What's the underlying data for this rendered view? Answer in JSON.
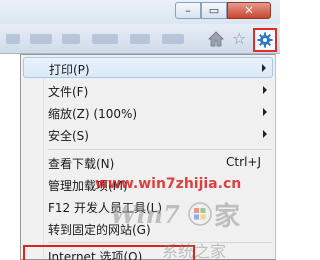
{
  "window": {
    "minimize_glyph": "–",
    "maximize_glyph": "▭",
    "close_glyph": "✕"
  },
  "toolbar": {
    "icons": [
      "home-icon",
      "favorites-star-icon",
      "tools-gear-icon"
    ],
    "highlight_color": "#e02b2b"
  },
  "menu": {
    "items": [
      {
        "label": "打印(P)",
        "submenu": true
      },
      {
        "label": "文件(F)",
        "submenu": true
      },
      {
        "label": "缩放(Z) (100%)",
        "submenu": true
      },
      {
        "label": "安全(S)",
        "submenu": true
      },
      {
        "label": "查看下载(N)",
        "shortcut": "Ctrl+J"
      },
      {
        "label": "管理加载项(M)"
      },
      {
        "label": "F12 开发人员工具(L)"
      },
      {
        "label": "转到固定的网站(G)"
      },
      {
        "label": "Internet 选项(O)"
      }
    ]
  },
  "watermark": {
    "url": "www.win7zhijia.cn",
    "logo_text": "Win7",
    "logo_suffix": "家",
    "bottom_text": "系统之家"
  }
}
